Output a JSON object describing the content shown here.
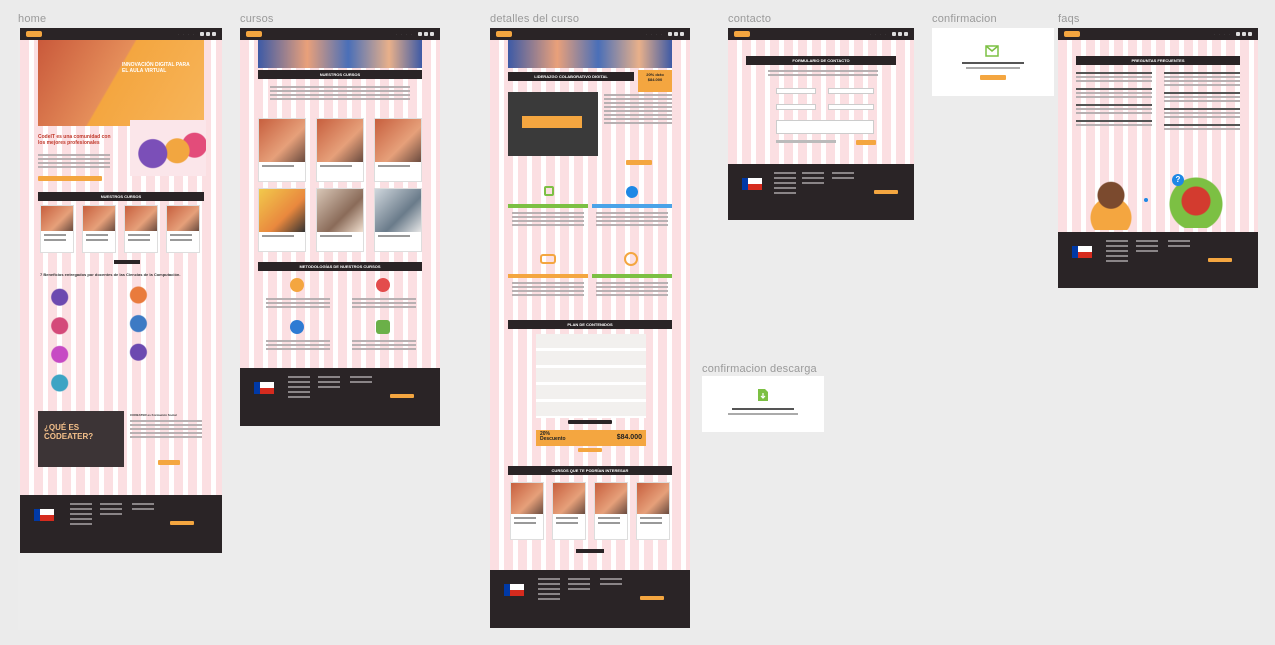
{
  "frames": {
    "home": {
      "label": "home",
      "hero_title": "INNOVACIÓN DIGITAL PARA EL AULA VIRTUAL",
      "community_title": "CodeIT es una comunidad con los mejores profesionales",
      "courses_title": "NUESTROS CURSOS",
      "benefits_title": "7 Beneficios entregados por docentes de las Ciencias de la Computación.",
      "que_es_title": "¿QUÉ ES CODEATER?",
      "que_es_heading": "CODEATER es Formación Social"
    },
    "cursos": {
      "label": "cursos",
      "courses_title": "NUESTROS CURSOS",
      "methods_title": "METODOLOGÍAS DE NUESTROS CURSOS"
    },
    "detalles": {
      "label": "detalles del curso",
      "course_title": "LIDERAZGO COLABORATIVO DIGITAL",
      "discount_badge": "20% dcto",
      "price_badge": "$84.000",
      "plan_title": "PLAN DE CONTENIDOS",
      "discount_big": "20% Descuento",
      "price_big": "$84.000",
      "related_title": "CURSOS QUE TE PODRÍAN INTERESAR"
    },
    "contacto": {
      "label": "contacto",
      "form_title": "FORMULARIO DE CONTACTO"
    },
    "confirmacion": {
      "label": "confirmacion"
    },
    "faqs": {
      "label": "faqs",
      "title": "PREGUNTAS FRECUENTES"
    },
    "confirmacion_descarga": {
      "label": "confirmacion descarga"
    }
  },
  "colors": {
    "canvas": "#ececec",
    "nav": "#2a2426",
    "accent": "#f4a640",
    "grid": "#f08c96",
    "green": "#7cc043"
  },
  "icons": [
    "envelope-check-icon",
    "download-file-icon",
    "question-icon"
  ]
}
